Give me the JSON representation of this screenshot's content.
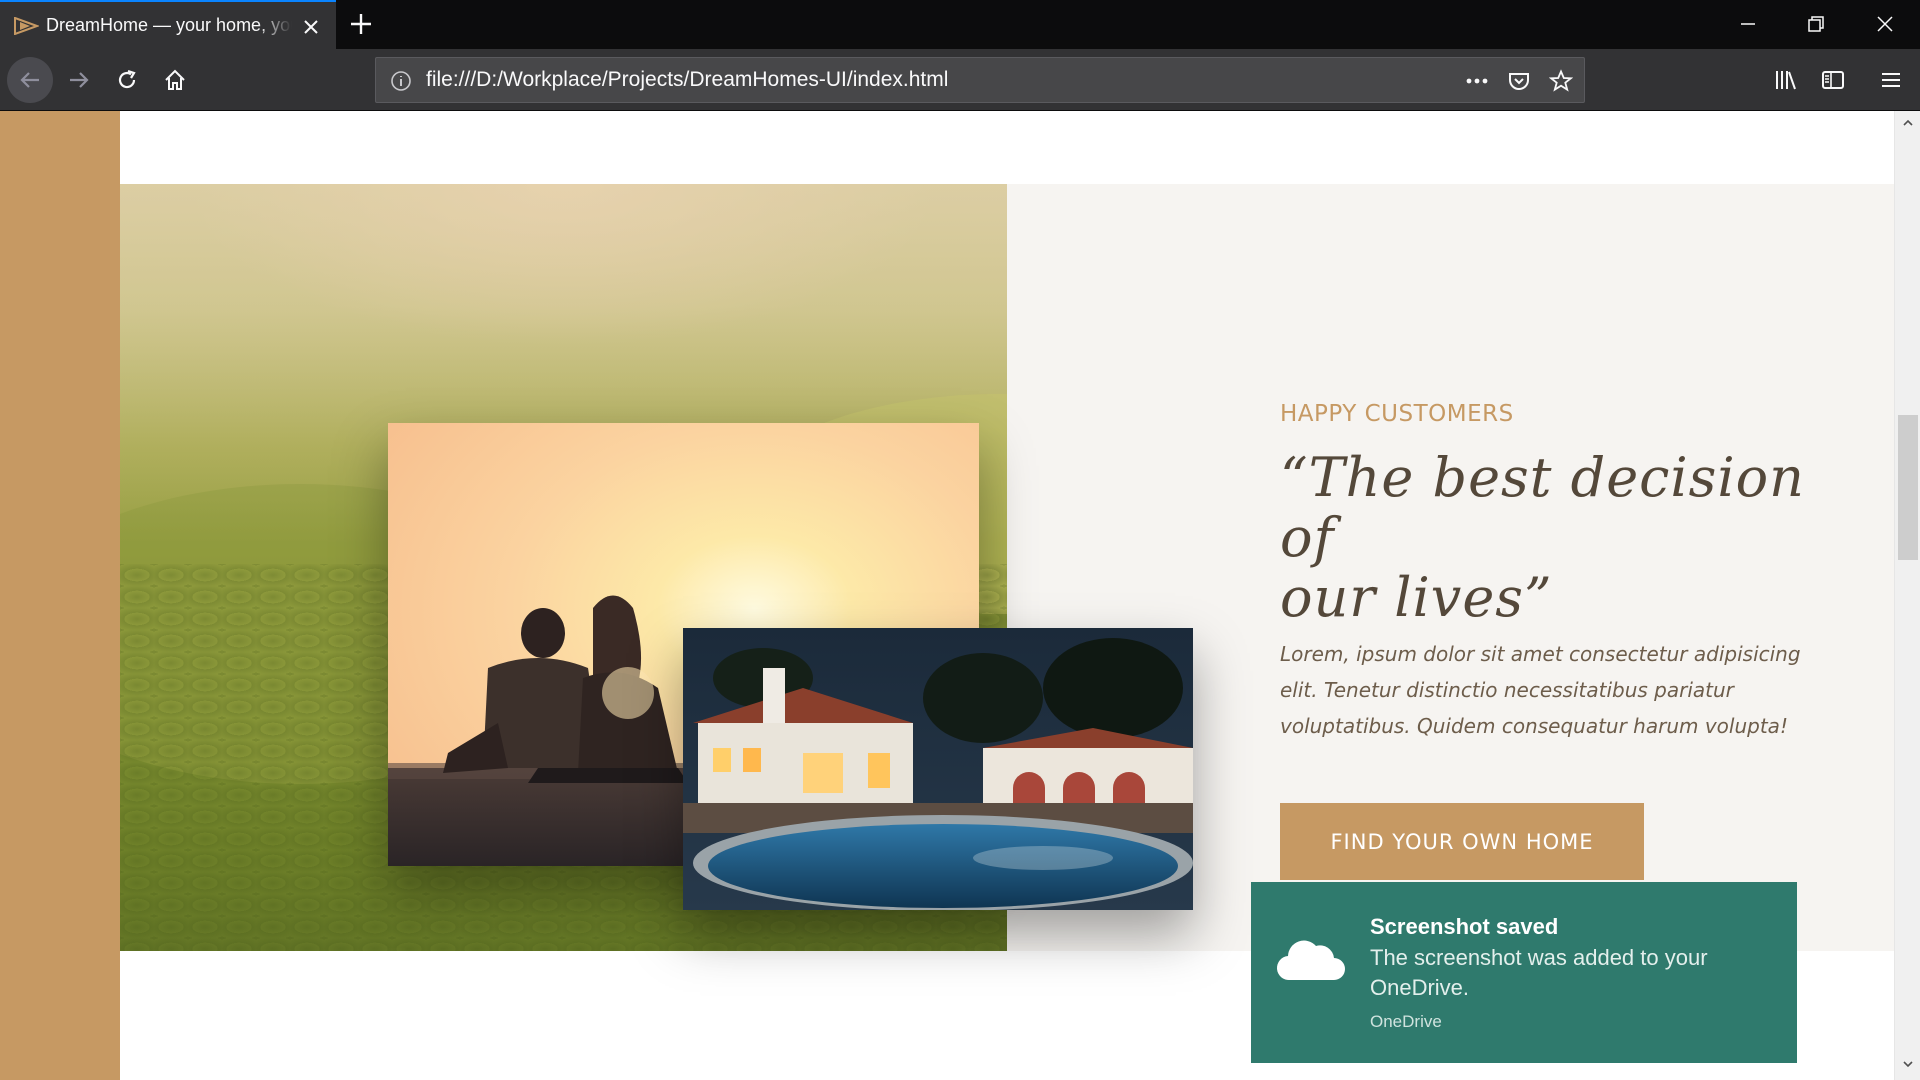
{
  "browser": {
    "tab": {
      "title": "DreamHome — your home, your freedom",
      "favicon": "play-logo-icon",
      "close_icon": "close-icon"
    },
    "new_tab_icon": "plus-icon",
    "window_controls": [
      "minimize-icon",
      "restore-icon",
      "close-icon"
    ],
    "nav": {
      "back_icon": "arrow-left-icon",
      "forward_icon": "arrow-right-icon",
      "reload_icon": "reload-icon",
      "home_icon": "home-icon"
    },
    "urlbar": {
      "info_icon": "info-icon",
      "url": "file:///D:/Workplace/Projects/DreamHomes-UI/index.html",
      "actions": [
        "more-icon",
        "pocket-icon",
        "star-icon"
      ]
    },
    "toolbar": [
      "library-icon",
      "sidebar-icon",
      "menu-icon"
    ]
  },
  "page": {
    "story": {
      "subheading": "Happy customers",
      "quote_line1": "“The best decision of",
      "quote_line2": "our lives”",
      "paragraph": "Lorem, ipsum dolor sit amet consectetur adipisicing elit. Tenetur distinctio necessitatibus pariatur voluptatibus. Quidem consequatur harum volupta!",
      "cta_label": "Find your own home"
    }
  },
  "toast": {
    "title": "Screenshot saved",
    "body": "The screenshot was added to your OneDrive.",
    "source": "OneDrive",
    "icon": "cloud-icon"
  },
  "colors": {
    "accent": "#c69963",
    "quote_text": "#54483a",
    "story_bg": "#f6f4f1",
    "toast_bg": "#2f7a6d",
    "browser_chrome": "#323234",
    "tab_highlight": "#0a84ff"
  }
}
